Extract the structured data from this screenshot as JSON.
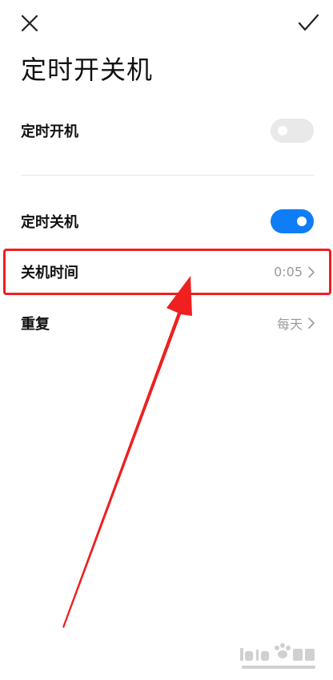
{
  "header": {
    "close_icon": "close-icon",
    "confirm_icon": "check-icon",
    "title": "定时开关机"
  },
  "settings": {
    "power_on": {
      "label": "定时开机",
      "enabled": false
    },
    "power_off": {
      "label": "定时关机",
      "enabled": true
    },
    "shutdown_time": {
      "label": "关机时间",
      "value": "0:05"
    },
    "repeat": {
      "label": "重复",
      "value": "每天"
    }
  },
  "colors": {
    "accent": "#0f7df5",
    "toggle_off": "#e9e9e9",
    "annotation": "#ee2020",
    "value_text": "#9a9a9a"
  }
}
